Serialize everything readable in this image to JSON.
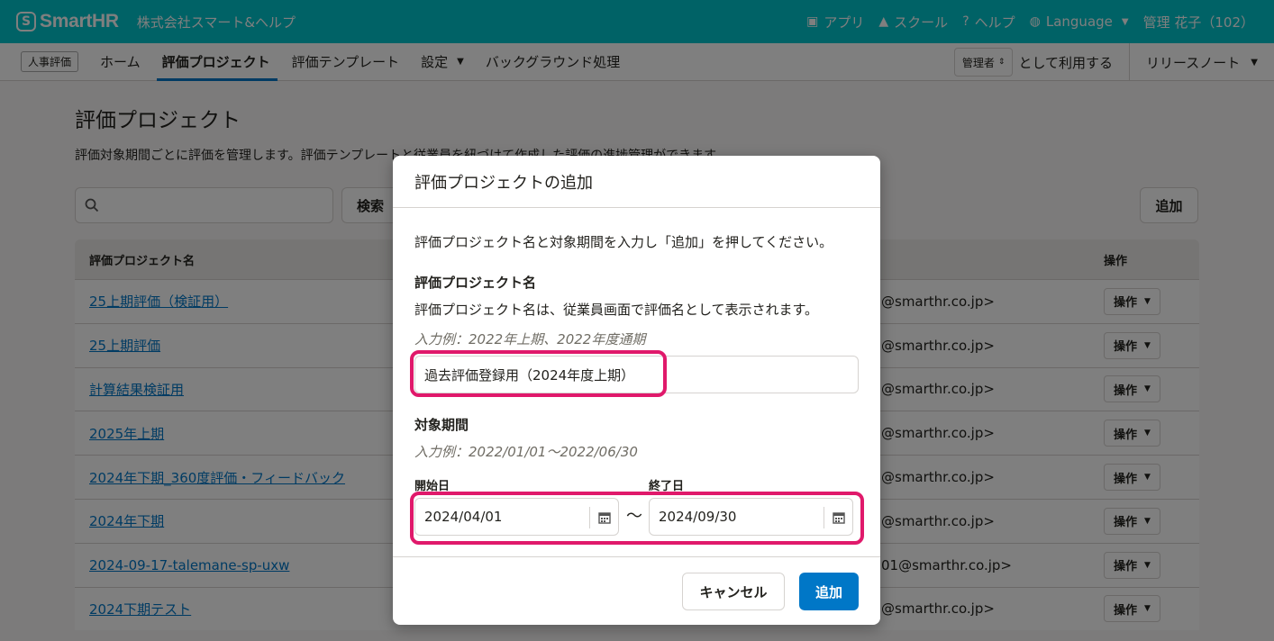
{
  "header": {
    "logo_text": "SmartHR",
    "tenant": "株式会社スマート&ヘルプ",
    "links": [
      {
        "icon": "toolbox-icon",
        "label": "アプリ"
      },
      {
        "icon": "graduation-cap-icon",
        "label": "スクール"
      },
      {
        "icon": "help-circle-icon",
        "label": "ヘルプ"
      }
    ],
    "language": "Language",
    "user": "管理 花子（102）"
  },
  "subnav": {
    "app_badge": "人事評価",
    "tabs": [
      "ホーム",
      "評価プロジェクト",
      "評価テンプレート",
      "設定",
      "バックグラウンド処理"
    ],
    "active_tab": "評価プロジェクト",
    "role": "管理者",
    "role_suffix": "として利用する",
    "release_notes": "リリースノート"
  },
  "page": {
    "title": "評価プロジェクト",
    "description": "評価対象期間ごとに評価を管理します。評価テンプレートと従業員を紐づけて作成した評価の進捗管理ができます。",
    "search_button": "検索",
    "add_button": "追加"
  },
  "table": {
    "col_name": "評価プロジェクト名",
    "col_op": "操作",
    "op_label": "操作",
    "rows": [
      {
        "name": "25上期評価（検証用）",
        "email": "@smarthr.co.jp>"
      },
      {
        "name": "25上期評価",
        "email": "@smarthr.co.jp>"
      },
      {
        "name": "計算結果検証用",
        "email": "@smarthr.co.jp>"
      },
      {
        "name": "2025年上期",
        "email": "@smarthr.co.jp>"
      },
      {
        "name": "2024年下期_360度評価・フィードバック",
        "email": "@smarthr.co.jp>"
      },
      {
        "name": "2024年下期",
        "email": "@smarthr.co.jp>"
      },
      {
        "name": "2024-09-17-talemane-sp-uxw",
        "email": "01@smarthr.co.jp>"
      },
      {
        "name": "2024下期テスト",
        "email": "@smarthr.co.jp>"
      }
    ]
  },
  "modal": {
    "title": "評価プロジェクトの追加",
    "instruction": "評価プロジェクト名と対象期間を入力し「追加」を押してください。",
    "name_label": "評価プロジェクト名",
    "name_help": "評価プロジェクト名は、従業員画面で評価名として表示されます。",
    "name_example": "入力例：2022年上期、2022年度通期",
    "name_value": "過去評価登録用（2024年度上期）",
    "period_label": "対象期間",
    "period_example": "入力例：2022/01/01〜2022/06/30",
    "start_label": "開始日",
    "start_value": "2024/04/01",
    "end_label": "終了日",
    "end_value": "2024/09/30",
    "tilde": "〜",
    "cancel": "キャンセル",
    "submit": "追加"
  },
  "colors": {
    "brand": "#00c4cc",
    "primary": "#0077c7",
    "highlight": "#e0196b"
  }
}
